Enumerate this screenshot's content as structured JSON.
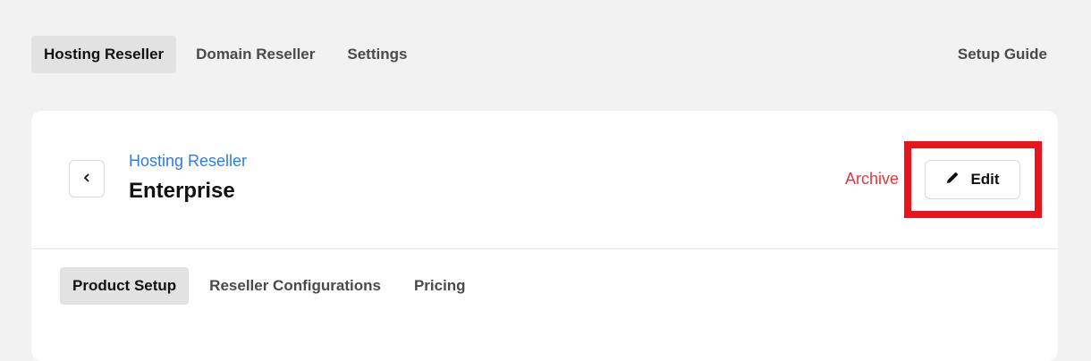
{
  "top_nav": {
    "tabs": [
      {
        "label": "Hosting Reseller",
        "active": true
      },
      {
        "label": "Domain Reseller",
        "active": false
      },
      {
        "label": "Settings",
        "active": false
      }
    ],
    "setup_guide_label": "Setup Guide"
  },
  "header": {
    "breadcrumb": "Hosting Reseller",
    "title": "Enterprise",
    "archive_label": "Archive",
    "edit_label": "Edit",
    "back_icon": "chevron-left-icon",
    "edit_icon": "pencil-icon"
  },
  "sub_tabs": [
    {
      "label": "Product Setup",
      "active": true
    },
    {
      "label": "Reseller Configurations",
      "active": false
    },
    {
      "label": "Pricing",
      "active": false
    }
  ],
  "colors": {
    "link": "#2f7de1",
    "danger": "#e0383e",
    "highlight": "#e8151d",
    "active_tab_bg": "#e2e2e2"
  }
}
